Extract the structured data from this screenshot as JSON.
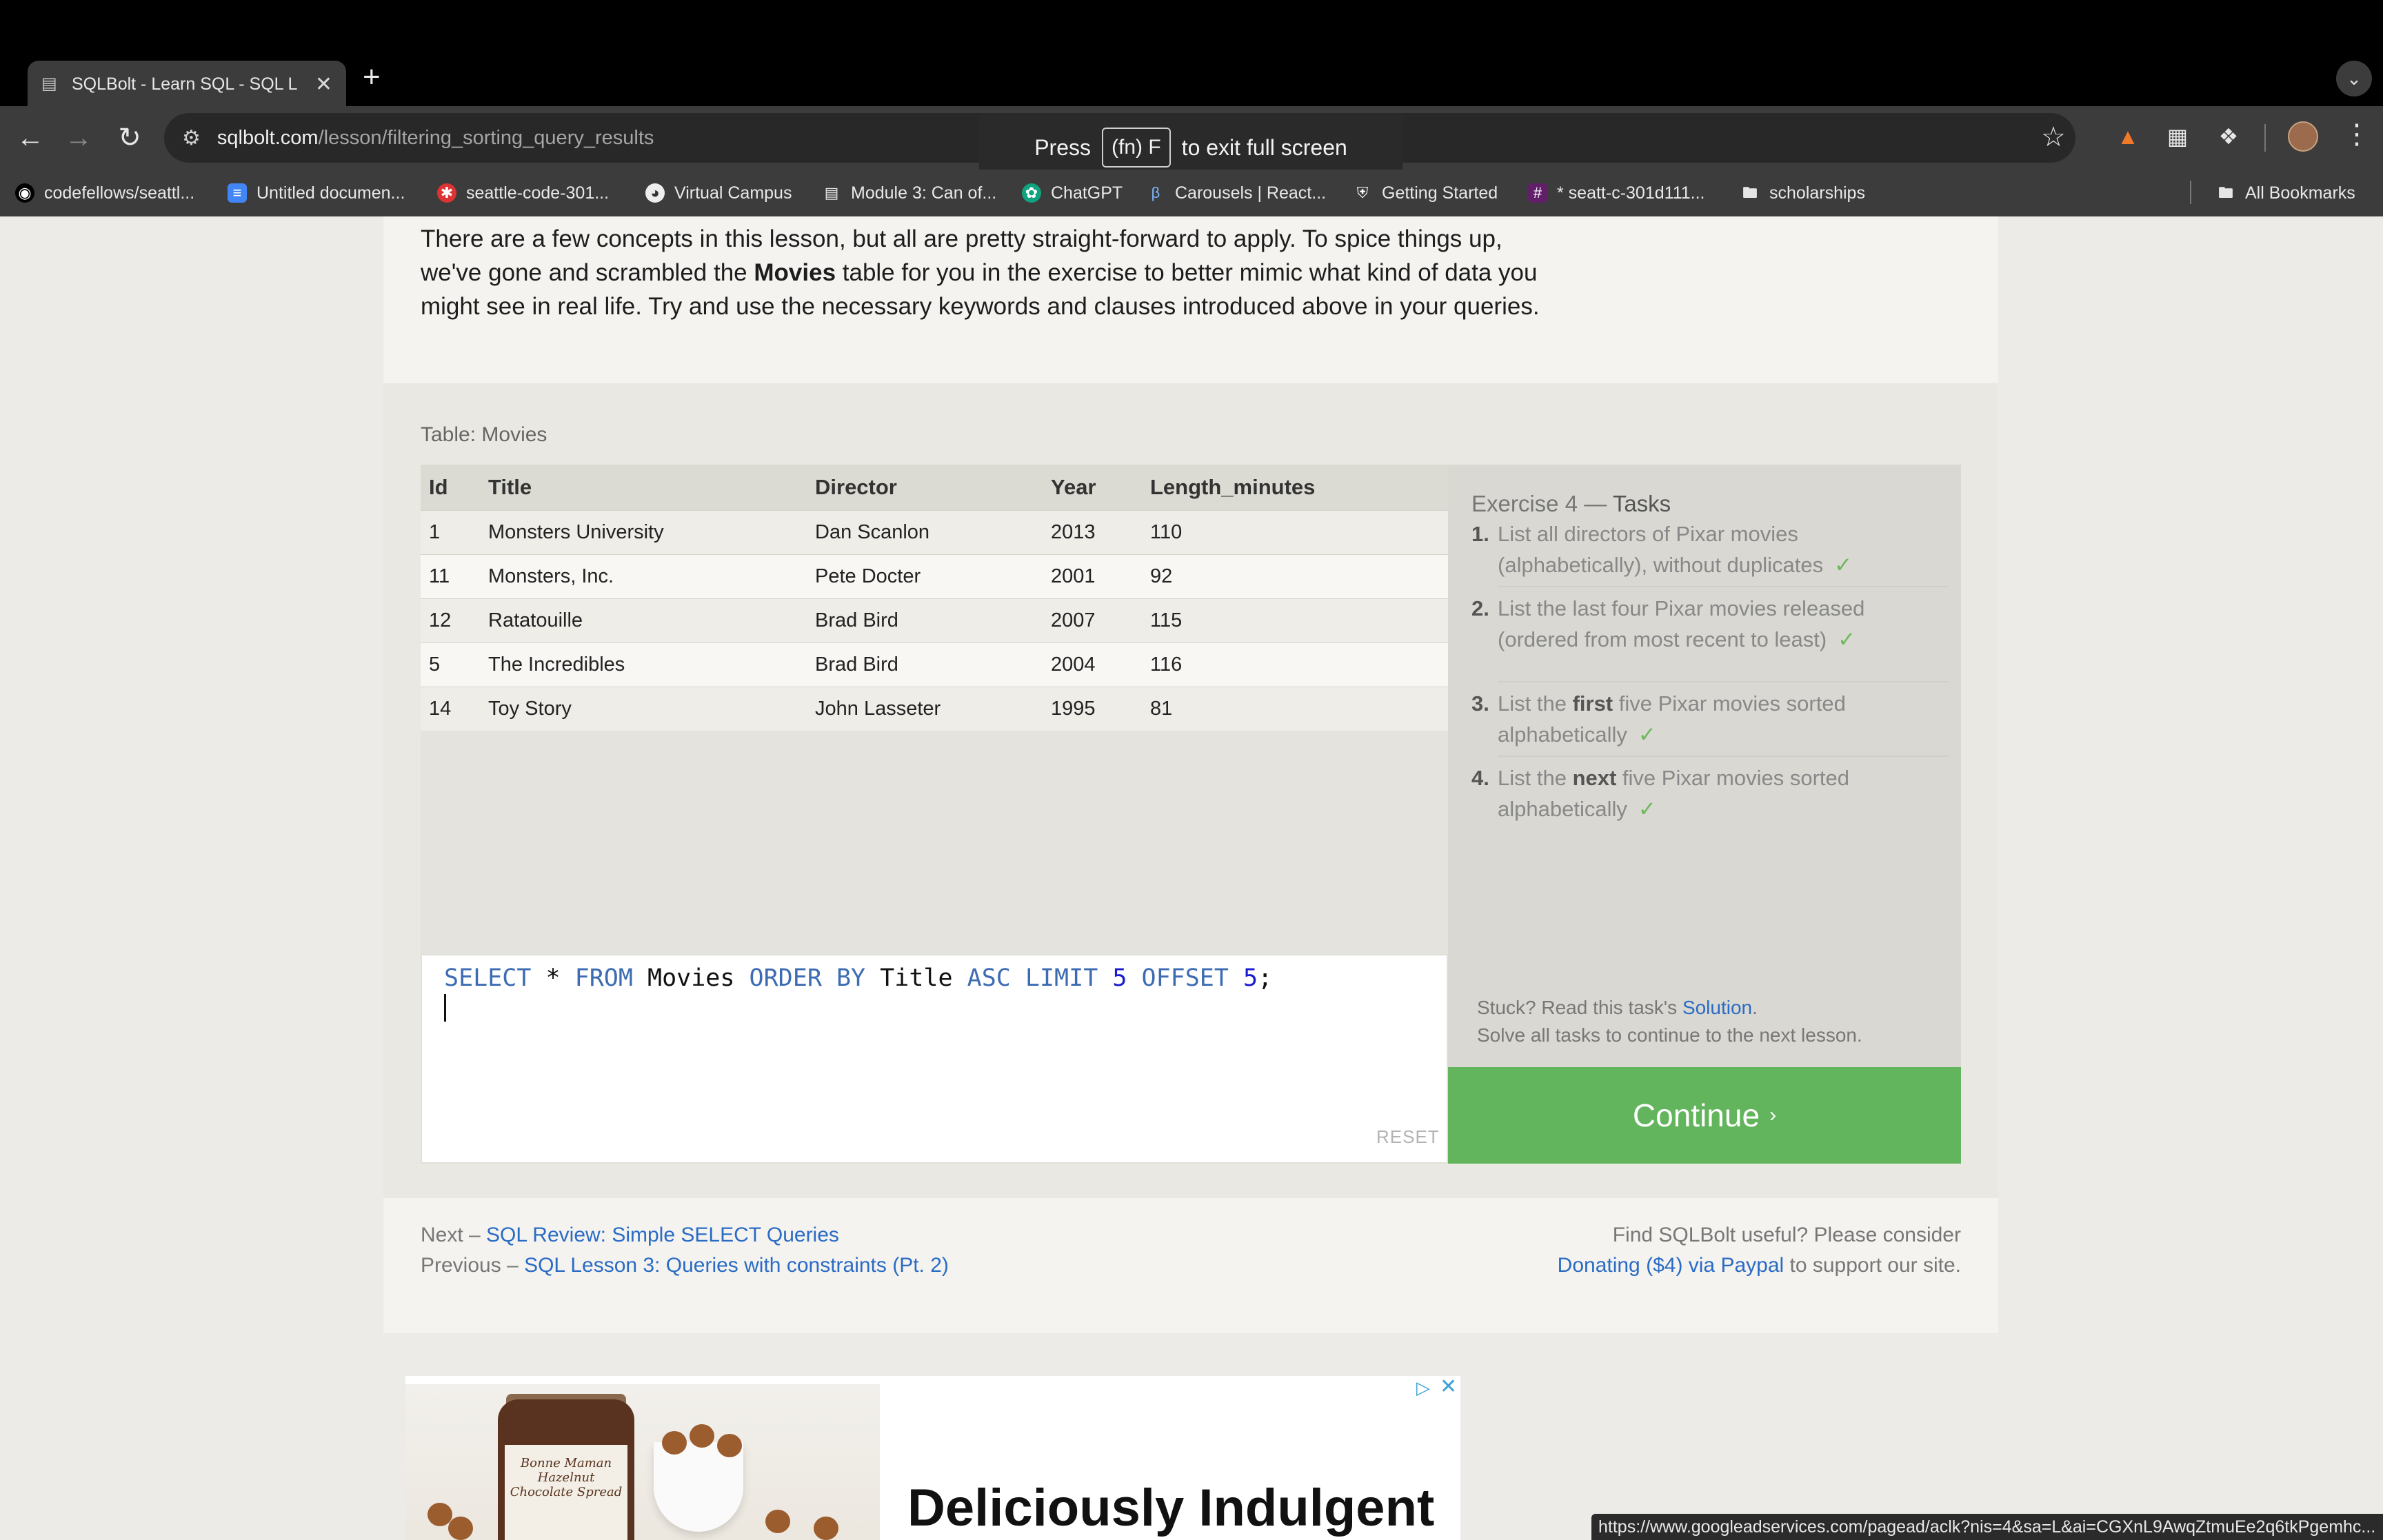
{
  "browser": {
    "tab_title": "SQLBolt - Learn SQL - SQL L",
    "url_domain": "sqlbolt.com",
    "url_path": "/lesson/filtering_sorting_query_results",
    "fullscreen_hint": {
      "before": "Press",
      "key": "(fn) F",
      "after": "to exit full screen"
    },
    "bookmarks": [
      {
        "label": "codefellows/seattl...",
        "icon": "github-icon"
      },
      {
        "label": "Untitled documen...",
        "icon": "docs-icon"
      },
      {
        "label": "seattle-code-301...",
        "icon": "asterisk-icon"
      },
      {
        "label": "Virtual Campus",
        "icon": "globe-icon"
      },
      {
        "label": "Module 3: Can of...",
        "icon": "canvas-icon"
      },
      {
        "label": "ChatGPT",
        "icon": "chatgpt-icon"
      },
      {
        "label": "Carousels | React...",
        "icon": "react-bootstrap-icon"
      },
      {
        "label": "Getting Started",
        "icon": "shield-icon"
      },
      {
        "label": "* seatt-c-301d111...",
        "icon": "slack-icon"
      },
      {
        "label": "scholarships",
        "icon": "folder-icon"
      }
    ],
    "all_bookmarks": "All Bookmarks",
    "status_url": "https://www.googleadservices.com/pagead/aclk?nis=4&sa=L&ai=CGXnL9AwqZtmuEe2q6tkPgemhc..."
  },
  "lesson": {
    "intro_parts": [
      "There are a few concepts in this lesson, but all are pretty straight-forward to apply. To spice things up, we've gone and scrambled the ",
      "Movies",
      " table for you in the exercise to better mimic what kind of data you might see in real life. Try and use the necessary keywords and clauses introduced above in your queries."
    ]
  },
  "table": {
    "caption": "Table: Movies",
    "columns": [
      "Id",
      "Title",
      "Director",
      "Year",
      "Length_minutes"
    ],
    "rows": [
      [
        "1",
        "Monsters University",
        "Dan Scanlon",
        "2013",
        "110"
      ],
      [
        "11",
        "Monsters, Inc.",
        "Pete Docter",
        "2001",
        "92"
      ],
      [
        "12",
        "Ratatouille",
        "Brad Bird",
        "2007",
        "115"
      ],
      [
        "5",
        "The Incredibles",
        "Brad Bird",
        "2004",
        "116"
      ],
      [
        "14",
        "Toy Story",
        "John Lasseter",
        "1995",
        "81"
      ]
    ]
  },
  "editor": {
    "query_tokens": [
      {
        "t": "SELECT",
        "c": "kw"
      },
      {
        "t": " * ",
        "c": "ident"
      },
      {
        "t": "FROM",
        "c": "kw"
      },
      {
        "t": " Movies ",
        "c": "ident"
      },
      {
        "t": "ORDER BY",
        "c": "kw"
      },
      {
        "t": " Title ",
        "c": "ident"
      },
      {
        "t": "ASC LIMIT",
        "c": "kw"
      },
      {
        "t": " 5 ",
        "c": "num"
      },
      {
        "t": "OFFSET",
        "c": "kw"
      },
      {
        "t": " 5",
        "c": "num"
      },
      {
        "t": ";",
        "c": "ident"
      }
    ],
    "reset_label": "RESET"
  },
  "tasks": {
    "title_prefix": "Exercise 4",
    "title_sep": " — ",
    "title_suffix": "Tasks",
    "items": [
      {
        "num": "1.",
        "before": "List all directors of Pixar movies (alphabetically), without duplicates",
        "bold": "",
        "after": "",
        "done": true
      },
      {
        "num": "2.",
        "before": "List the last four Pixar movies released (ordered from most recent to least)",
        "bold": "",
        "after": "",
        "done": true
      },
      {
        "num": "3.",
        "before": "List the ",
        "bold": "first",
        "after": " five Pixar movies sorted alphabetically",
        "done": true
      },
      {
        "num": "4.",
        "before": "List the ",
        "bold": "next",
        "after": " five Pixar movies sorted alphabetically",
        "done": true
      }
    ],
    "check_mark": "✓",
    "stuck_prefix": "Stuck? Read this task's ",
    "stuck_link": "Solution",
    "stuck_suffix": ".",
    "solve_all": "Solve all tasks to continue to the next lesson.",
    "continue_label": "Continue",
    "continue_chevron": "›"
  },
  "footer": {
    "next_prefix": "Next – ",
    "next_link": "SQL Review: Simple SELECT Queries",
    "prev_prefix": "Previous – ",
    "prev_link": "SQL Lesson 3: Queries with constraints (Pt. 2)",
    "support_line1": "Find SQLBolt useful? Please consider",
    "donate_link": "Donating ($4) via Paypal",
    "support_suffix": " to support our site."
  },
  "ad": {
    "headline": "Deliciously Indulgent",
    "jar_label": "Bonne Maman Hazelnut Chocolate Spread"
  },
  "colors": {
    "accent_green": "#62b55c",
    "link_blue": "#2a6bc4",
    "sql_keyword": "#3d6cb3",
    "check_green": "#6cb85b"
  }
}
